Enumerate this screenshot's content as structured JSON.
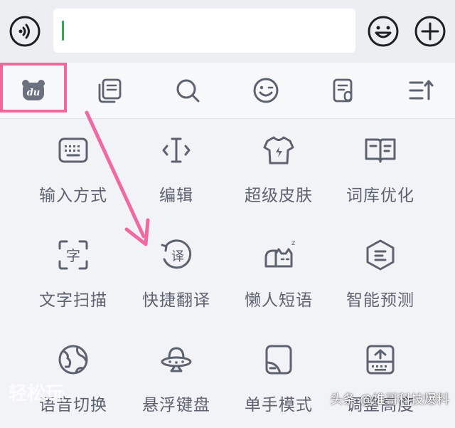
{
  "input_bar": {
    "voice_icon": "voice-icon",
    "emoji_icon": "smiley-icon",
    "plus_icon": "plus-icon",
    "text_value": ""
  },
  "toolbar": {
    "items": [
      {
        "name": "du-logo",
        "icon": "du-bear-logo",
        "highlighted": true
      },
      {
        "name": "clipboard",
        "icon": "clipboard-icon"
      },
      {
        "name": "search",
        "icon": "search-icon"
      },
      {
        "name": "emoji",
        "icon": "wink-face-icon"
      },
      {
        "name": "doc-edit",
        "icon": "doc-edit-icon"
      },
      {
        "name": "menu",
        "icon": "collapse-menu-icon"
      }
    ],
    "highlight_color": "#f0679a"
  },
  "grid": {
    "items": [
      {
        "label": "输入方式",
        "icon": "keyboard-icon"
      },
      {
        "label": "编辑",
        "icon": "text-cursor-icon"
      },
      {
        "label": "超级皮肤",
        "icon": "tshirt-icon"
      },
      {
        "label": "词库优化",
        "icon": "book-icon"
      },
      {
        "label": "文字扫描",
        "icon": "scan-char-icon"
      },
      {
        "label": "快捷翻译",
        "icon": "translate-icon"
      },
      {
        "label": "懒人短语",
        "icon": "sleeping-cat-icon"
      },
      {
        "label": "智能预测",
        "icon": "predict-icon"
      },
      {
        "label": "语音切换",
        "icon": "globe-icon"
      },
      {
        "label": "悬浮键盘",
        "icon": "ufo-icon"
      },
      {
        "label": "单手模式",
        "icon": "one-hand-icon"
      },
      {
        "label": "调整高度",
        "icon": "adjust-height-icon"
      }
    ]
  },
  "annotation": {
    "arrow_color": "#ef6aa0"
  },
  "watermark": {
    "right": "头条 @推哥科技爆料",
    "left": "轻松玩"
  },
  "colors": {
    "icon": "#5c6270",
    "background": "#f2f3f6",
    "caret": "#2bb24c"
  }
}
